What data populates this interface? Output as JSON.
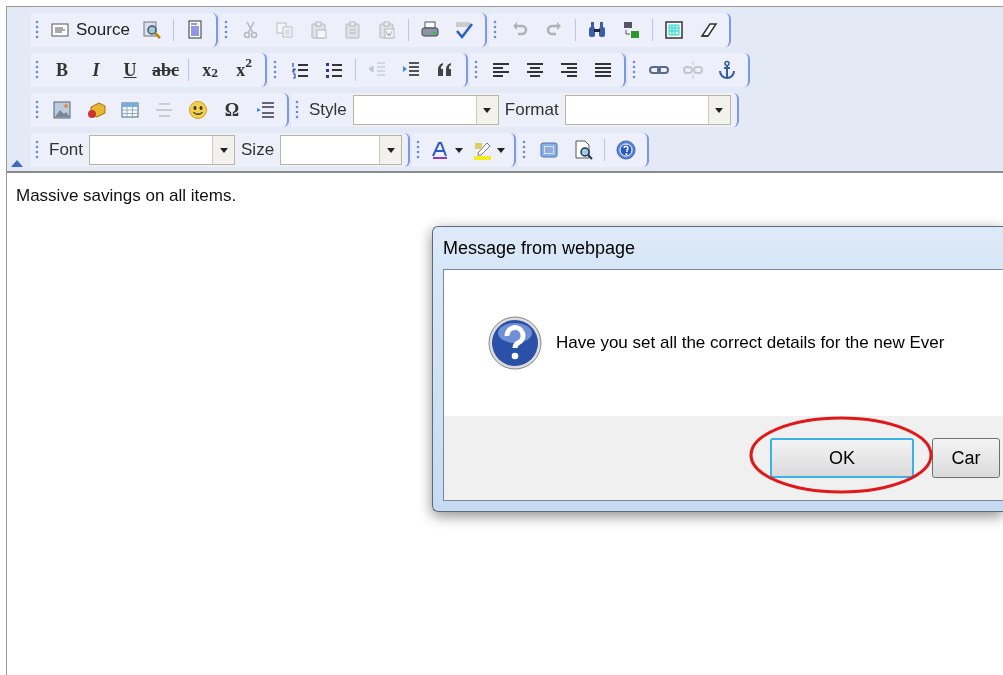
{
  "toolbar": {
    "rows": [
      {
        "groups": [
          [
            {
              "kind": "text-button",
              "label": "Source",
              "disabled": false
            },
            {
              "kind": "icon",
              "disabled": false
            },
            {
              "kind": "separator"
            },
            {
              "kind": "icon",
              "disabled": false
            }
          ],
          [
            {
              "kind": "icon",
              "disabled": true
            },
            {
              "kind": "icon",
              "disabled": true
            },
            {
              "kind": "icon",
              "disabled": true
            },
            {
              "kind": "icon",
              "disabled": true
            },
            {
              "kind": "icon",
              "disabled": true
            },
            {
              "kind": "separator"
            },
            {
              "kind": "icon",
              "disabled": false
            },
            {
              "kind": "icon",
              "disabled": false
            }
          ],
          [
            {
              "kind": "icon",
              "disabled": true
            },
            {
              "kind": "icon",
              "disabled": true
            },
            {
              "kind": "separator"
            },
            {
              "kind": "icon",
              "disabled": false
            },
            {
              "kind": "icon",
              "disabled": false
            },
            {
              "kind": "separator"
            },
            {
              "kind": "icon",
              "disabled": false
            },
            {
              "kind": "icon",
              "disabled": false
            }
          ]
        ]
      },
      {
        "groups": [
          [
            {
              "kind": "glyph",
              "text": "B",
              "disabled": false
            },
            {
              "kind": "glyph",
              "text": "I",
              "disabled": false
            },
            {
              "kind": "glyph",
              "text": "U",
              "disabled": false
            },
            {
              "kind": "glyph",
              "text": "abc",
              "disabled": false
            },
            {
              "kind": "separator"
            },
            {
              "kind": "glyph",
              "text": "x$_{2}$",
              "disabled": false
            },
            {
              "kind": "glyph",
              "text": "x$^{2}$",
              "disabled": false
            }
          ],
          [
            {
              "kind": "icon",
              "disabled": false
            },
            {
              "kind": "icon",
              "disabled": false
            },
            {
              "kind": "separator"
            },
            {
              "kind": "icon",
              "disabled": true
            },
            {
              "kind": "icon",
              "disabled": false
            },
            {
              "kind": "icon",
              "disabled": false
            }
          ],
          [
            {
              "kind": "icon",
              "disabled": false
            },
            {
              "kind": "icon",
              "disabled": false
            },
            {
              "kind": "icon",
              "disabled": false
            },
            {
              "kind": "icon",
              "disabled": false
            }
          ],
          [
            {
              "kind": "icon",
              "disabled": false
            },
            {
              "kind": "icon",
              "disabled": true
            },
            {
              "kind": "icon",
              "disabled": false
            }
          ]
        ]
      },
      {
        "groups": [
          [
            {
              "kind": "icon",
              "disabled": false
            },
            {
              "kind": "icon",
              "disabled": false
            },
            {
              "kind": "icon",
              "disabled": false
            },
            {
              "kind": "icon",
              "disabled": true
            },
            {
              "kind": "icon",
              "disabled": false
            },
            {
              "kind": "glyph",
              "text": "Ω",
              "disabled": false
            },
            {
              "kind": "icon",
              "disabled": false
            }
          ],
          [
            {
              "kind": "combo",
              "label": "Style"
            },
            {
              "kind": "combo",
              "label": "Format"
            }
          ]
        ]
      },
      {
        "groups": [
          [
            {
              "kind": "combo",
              "label": "Font"
            },
            {
              "kind": "combo",
              "label": "Size"
            }
          ],
          [
            {
              "kind": "color-button",
              "disabled": false
            },
            {
              "kind": "color-button",
              "disabled": false
            }
          ],
          [
            {
              "kind": "icon",
              "disabled": false
            },
            {
              "kind": "icon",
              "disabled": false
            },
            {
              "kind": "separator"
            },
            {
              "kind": "icon",
              "disabled": false
            }
          ]
        ]
      }
    ]
  },
  "editor": {
    "text": "Massive savings on all items."
  },
  "dialog": {
    "title": "Message from webpage",
    "message": "Have you set all the correct details for the new Ever",
    "buttons": [
      {
        "label": "OK",
        "focused": true
      },
      {
        "label": "Car",
        "focused": false
      }
    ]
  }
}
